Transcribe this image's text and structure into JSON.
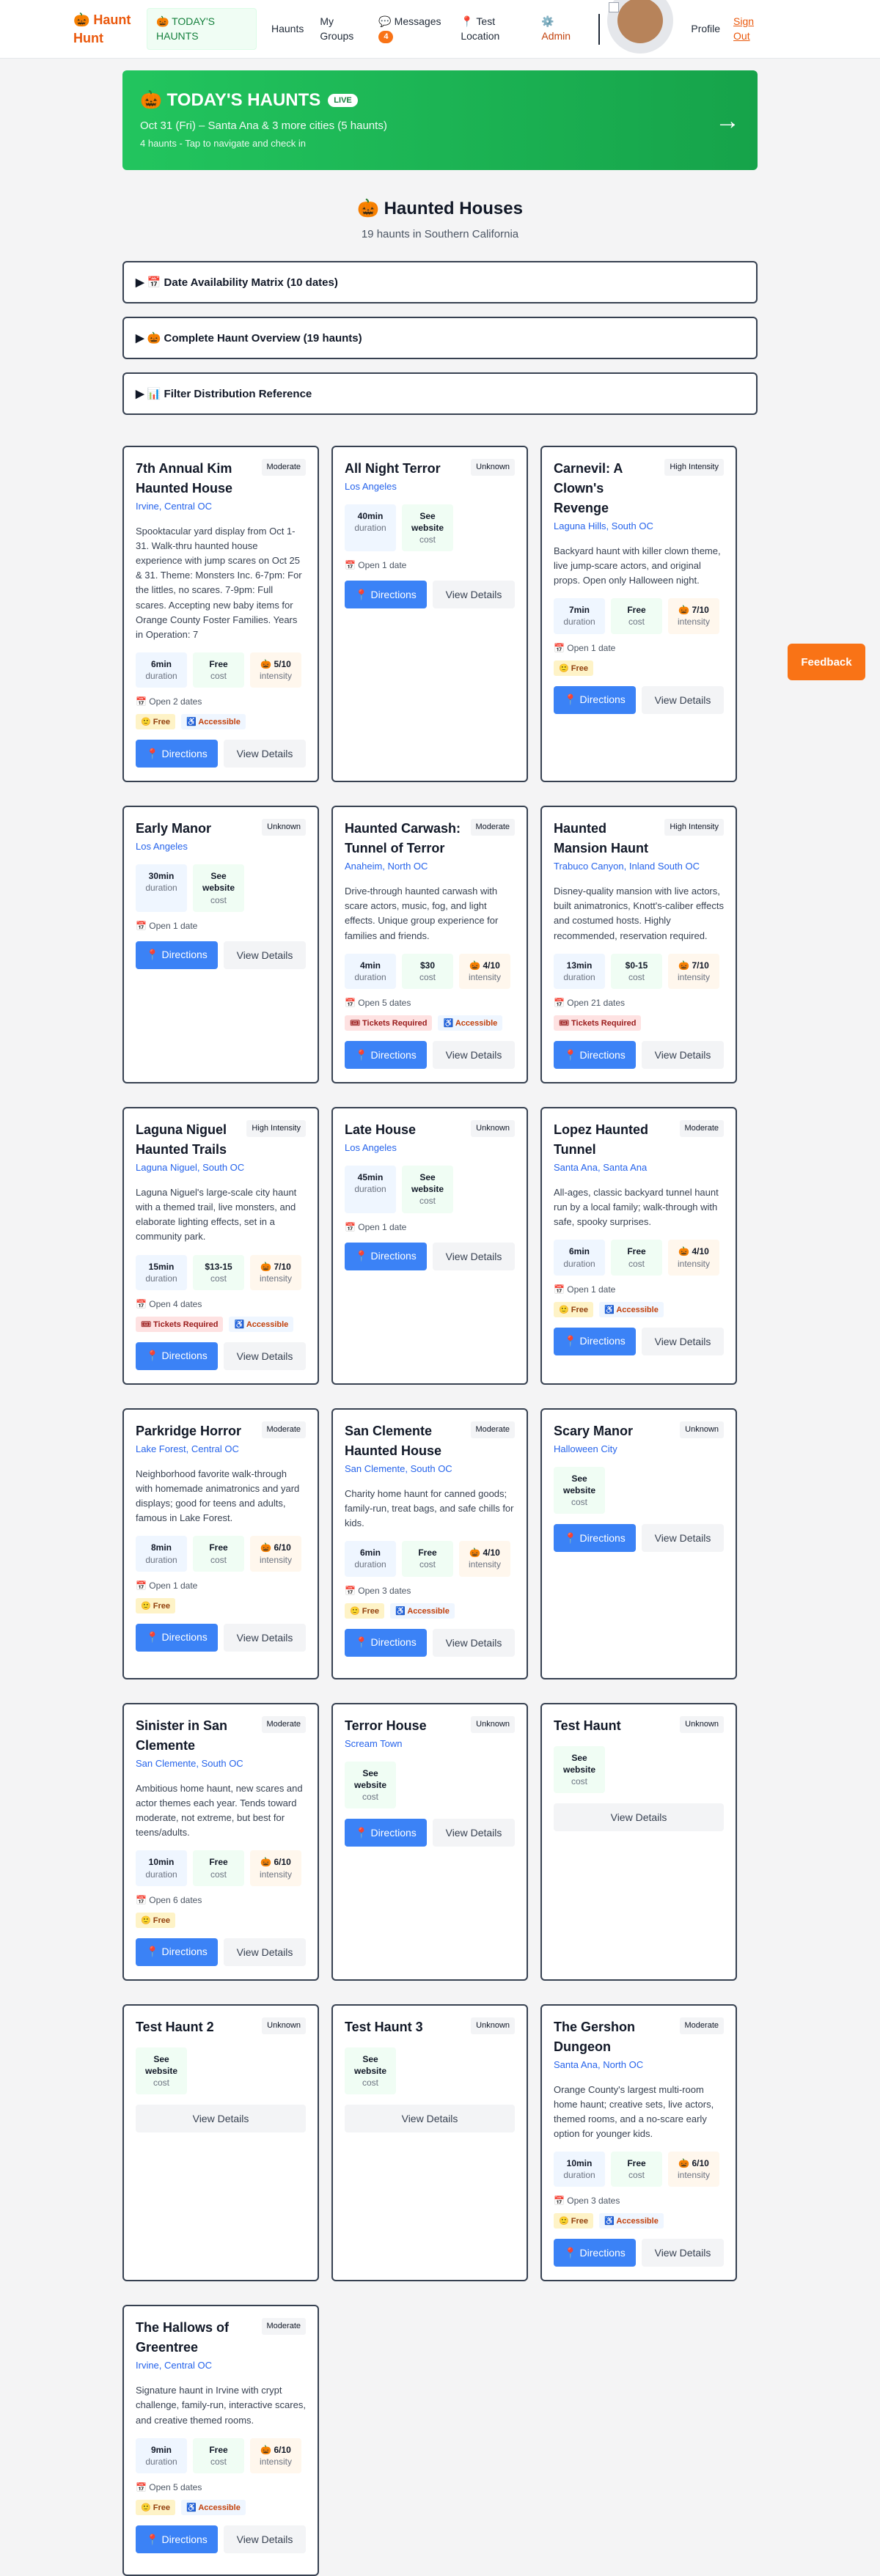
{
  "nav": {
    "brand": "🎃 Haunt Hunt",
    "todays": "🎃 TODAY'S HAUNTS",
    "haunts": "Haunts",
    "groups": "My Groups",
    "messages": "💬 Messages",
    "messages_count": "4",
    "test_location": "📍 Test Location",
    "admin": "⚙️ Admin",
    "profile": "Profile",
    "signout": "Sign Out"
  },
  "banner": {
    "title": "🎃 TODAY'S HAUNTS",
    "live": "LIVE",
    "subtitle": "Oct 31 (Fri) – Santa Ana & 3 more cities (5 haunts)",
    "hint": "4 haunts - Tap to navigate and check in",
    "arrow": "→"
  },
  "page": {
    "title": "🎃 Haunted Houses",
    "subtitle": "19 haunts in Southern California"
  },
  "sections": [
    "▶ 📅 Date Availability Matrix (10 dates)",
    "▶ 🎃 Complete Haunt Overview (19 haunts)",
    "▶ 📊 Filter Distribution Reference"
  ],
  "labels": {
    "duration": "duration",
    "cost": "cost",
    "intensity": "intensity",
    "directions": "📍 Directions",
    "details": "View Details",
    "free_tag": "🙂 Free",
    "access_tag": "♿ Accessible",
    "tickets_tag": "🎟 Tickets Required"
  },
  "feedback": "Feedback",
  "cards": [
    {
      "title": "7th Annual Kim Haunted House",
      "level": "Moderate",
      "location": "Irvine, Central OC",
      "description": "Spooktacular yard display from Oct 1-31. Walk-thru haunted house experience with jump scares on Oct 25 & 31. Theme: Monsters Inc. 6-7pm: For the littles, no scares. 7-9pm: Full scares. Accepting new baby items for Orange County Foster Families. Years in Operation: 7",
      "duration": "6min",
      "cost": "Free",
      "intensity": "🎃 5/10",
      "dates": "📅 Open 2 dates",
      "tags": [
        "free",
        "access"
      ],
      "directions": true
    },
    {
      "title": "All Night Terror",
      "level": "Unknown",
      "location": "Los Angeles",
      "description": "",
      "duration": "40min",
      "cost": "See website",
      "intensity": "",
      "dates": "📅 Open 1 date",
      "tags": [],
      "directions": true
    },
    {
      "title": "Carnevil: A Clown's Revenge",
      "level": "High Intensity",
      "location": "Laguna Hills, South OC",
      "description": "Backyard haunt with killer clown theme, live jump-scare actors, and original props. Open only Halloween night.",
      "duration": "7min",
      "cost": "Free",
      "intensity": "🎃 7/10",
      "dates": "📅 Open 1 date",
      "tags": [
        "free"
      ],
      "directions": true
    },
    {
      "title": "Early Manor",
      "level": "Unknown",
      "location": "Los Angeles",
      "description": "",
      "duration": "30min",
      "cost": "See website",
      "intensity": "",
      "dates": "📅 Open 1 date",
      "tags": [],
      "directions": true
    },
    {
      "title": "Haunted Carwash: Tunnel of Terror",
      "level": "Moderate",
      "location": "Anaheim, North OC",
      "description": "Drive-through haunted carwash with scare actors, music, fog, and light effects. Unique group experience for families and friends.",
      "duration": "4min",
      "cost": "$30",
      "intensity": "🎃 4/10",
      "dates": "📅 Open 5 dates",
      "tags": [
        "tickets",
        "access"
      ],
      "directions": true
    },
    {
      "title": "Haunted Mansion Haunt",
      "level": "High Intensity",
      "location": "Trabuco Canyon, Inland South OC",
      "description": "Disney-quality mansion with live actors, built animatronics, Knott's-caliber effects and costumed hosts. Highly recommended, reservation required.",
      "duration": "13min",
      "cost": "$0-15",
      "intensity": "🎃 7/10",
      "dates": "📅 Open 21 dates",
      "tags": [
        "tickets"
      ],
      "directions": true
    },
    {
      "title": "Laguna Niguel Haunted Trails",
      "level": "High Intensity",
      "location": "Laguna Niguel, South OC",
      "description": "Laguna Niguel's large-scale city haunt with a themed trail, live monsters, and elaborate lighting effects, set in a community park.",
      "duration": "15min",
      "cost": "$13-15",
      "intensity": "🎃 7/10",
      "dates": "📅 Open 4 dates",
      "tags": [
        "tickets",
        "access"
      ],
      "directions": true
    },
    {
      "title": "Late House",
      "level": "Unknown",
      "location": "Los Angeles",
      "description": "",
      "duration": "45min",
      "cost": "See website",
      "intensity": "",
      "dates": "📅 Open 1 date",
      "tags": [],
      "directions": true
    },
    {
      "title": "Lopez Haunted Tunnel",
      "level": "Moderate",
      "location": "Santa Ana, Santa Ana",
      "description": "All-ages, classic backyard tunnel haunt run by a local family; walk-through with safe, spooky surprises.",
      "duration": "6min",
      "cost": "Free",
      "intensity": "🎃 4/10",
      "dates": "📅 Open 1 date",
      "tags": [
        "free",
        "access"
      ],
      "directions": true
    },
    {
      "title": "Parkridge Horror",
      "level": "Moderate",
      "location": "Lake Forest, Central OC",
      "description": "Neighborhood favorite walk-through with homemade animatronics and yard displays; good for teens and adults, famous in Lake Forest.",
      "duration": "8min",
      "cost": "Free",
      "intensity": "🎃 6/10",
      "dates": "📅 Open 1 date",
      "tags": [
        "free"
      ],
      "directions": true
    },
    {
      "title": "San Clemente Haunted House",
      "level": "Moderate",
      "location": "San Clemente, South OC",
      "description": "Charity home haunt for canned goods; family-run, treat bags, and safe chills for kids.",
      "duration": "6min",
      "cost": "Free",
      "intensity": "🎃 4/10",
      "dates": "📅 Open 3 dates",
      "tags": [
        "free",
        "access"
      ],
      "directions": true
    },
    {
      "title": "Scary Manor",
      "level": "Unknown",
      "location": "Halloween City",
      "description": "",
      "duration": "",
      "cost": "See website",
      "intensity": "",
      "dates": "",
      "tags": [],
      "directions": true
    },
    {
      "title": "Sinister in San Clemente",
      "level": "Moderate",
      "location": "San Clemente, South OC",
      "description": "Ambitious home haunt, new scares and actor themes each year. Tends toward moderate, not extreme, but best for teens/adults.",
      "duration": "10min",
      "cost": "Free",
      "intensity": "🎃 6/10",
      "dates": "📅 Open 6 dates",
      "tags": [
        "free"
      ],
      "directions": true
    },
    {
      "title": "Terror House",
      "level": "Unknown",
      "location": "Scream Town",
      "description": "",
      "duration": "",
      "cost": "See website",
      "intensity": "",
      "dates": "",
      "tags": [],
      "directions": true
    },
    {
      "title": "Test Haunt",
      "level": "Unknown",
      "location": "",
      "description": "",
      "duration": "",
      "cost": "See website",
      "intensity": "",
      "dates": "",
      "tags": [],
      "directions": false
    },
    {
      "title": "Test Haunt 2",
      "level": "Unknown",
      "location": "",
      "description": "",
      "duration": "",
      "cost": "See website",
      "intensity": "",
      "dates": "",
      "tags": [],
      "directions": false
    },
    {
      "title": "Test Haunt 3",
      "level": "Unknown",
      "location": "",
      "description": "",
      "duration": "",
      "cost": "See website",
      "intensity": "",
      "dates": "",
      "tags": [],
      "directions": false
    },
    {
      "title": "The Gershon Dungeon",
      "level": "Moderate",
      "location": "Santa Ana, North OC",
      "description": "Orange County's largest multi-room home haunt; creative sets, live actors, themed rooms, and a no-scare early option for younger kids.",
      "duration": "10min",
      "cost": "Free",
      "intensity": "🎃 6/10",
      "dates": "📅 Open 3 dates",
      "tags": [
        "free",
        "access"
      ],
      "directions": true
    },
    {
      "title": "The Hallows of Greentree",
      "level": "Moderate",
      "location": "Irvine, Central OC",
      "description": "Signature haunt in Irvine with crypt challenge, family-run, interactive scares, and creative themed rooms.",
      "duration": "9min",
      "cost": "Free",
      "intensity": "🎃 6/10",
      "dates": "📅 Open 5 dates",
      "tags": [
        "free",
        "access"
      ],
      "directions": true
    }
  ]
}
